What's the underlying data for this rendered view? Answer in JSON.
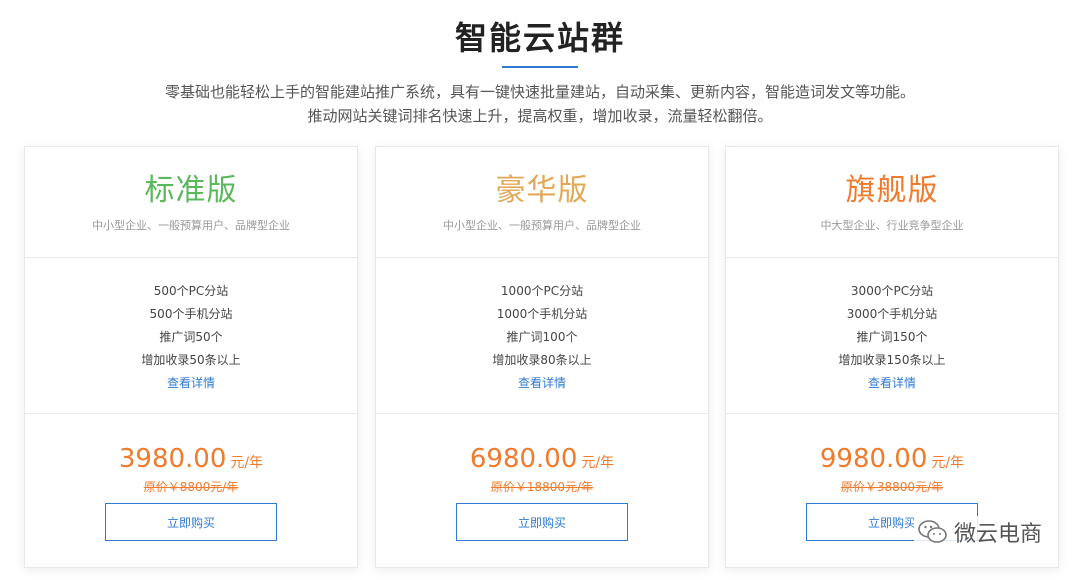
{
  "header": {
    "title": "智能云站群",
    "desc_line1": "零基础也能轻松上手的智能建站推广系统，具有一键快速批量建站，自动采集、更新内容，智能造词发文等功能。",
    "desc_line2": "推动网站关键词排名快速上升，提高权重，增加收录，流量轻松翻倍。"
  },
  "plans": [
    {
      "name": "标准版",
      "color": "#5cb85c",
      "target": "中小型企业、一般预算用户、品牌型企业",
      "features": [
        "500个PC分站",
        "500个手机分站",
        "推广词50个",
        "增加收录50条以上"
      ],
      "details_label": "查看详情",
      "price": "3980.00",
      "unit": "元/年",
      "original": "原价￥8800元/年",
      "buy_label": "立即购买"
    },
    {
      "name": "豪华版",
      "color": "#e3a857",
      "target": "中小型企业、一般预算用户、品牌型企业",
      "features": [
        "1000个PC分站",
        "1000个手机分站",
        "推广词100个",
        "增加收录80条以上"
      ],
      "details_label": "查看详情",
      "price": "6980.00",
      "unit": "元/年",
      "original": "原价￥18800元/年",
      "buy_label": "立即购买"
    },
    {
      "name": "旗舰版",
      "color": "#f07b2d",
      "target": "中大型企业、行业竞争型企业",
      "features": [
        "3000个PC分站",
        "3000个手机分站",
        "推广词150个",
        "增加收录150条以上"
      ],
      "details_label": "查看详情",
      "price": "9980.00",
      "unit": "元/年",
      "original": "原价￥38800元/年",
      "buy_label": "立即购买"
    }
  ],
  "watermark": {
    "icon": "wechat-icon",
    "text": "微云电商"
  }
}
